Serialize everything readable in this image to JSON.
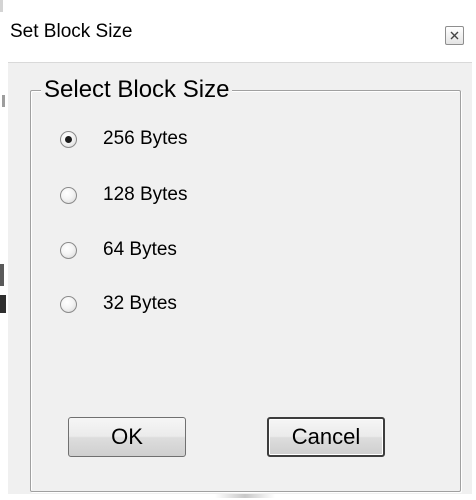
{
  "window": {
    "title": "Set Block Size",
    "close_icon": "close-icon"
  },
  "group": {
    "label": "Select Block Size",
    "options": [
      {
        "label": "256 Bytes",
        "checked": true
      },
      {
        "label": "128 Bytes",
        "checked": false
      },
      {
        "label": "64 Bytes",
        "checked": false
      },
      {
        "label": "32 Bytes",
        "checked": false
      }
    ]
  },
  "buttons": {
    "ok_label": "OK",
    "cancel_label": "Cancel"
  },
  "colors": {
    "dialog_background": "#f0f0f0",
    "title_background": "#ffffff",
    "border": "#a0a0a0"
  }
}
